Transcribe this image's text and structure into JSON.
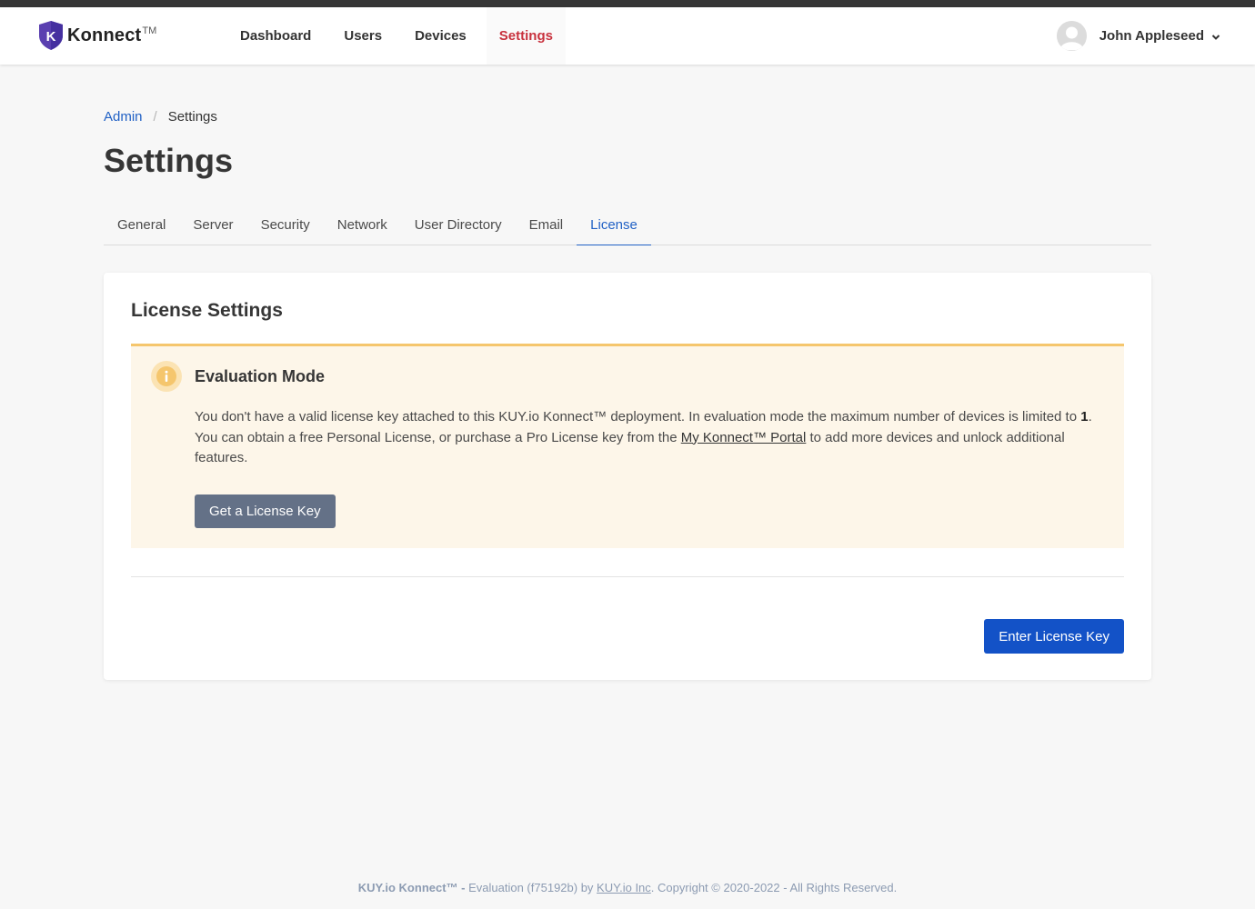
{
  "brand": {
    "name": "Konnect",
    "tm": "TM",
    "logo_letter": "K"
  },
  "nav": {
    "items": [
      {
        "label": "Dashboard"
      },
      {
        "label": "Users"
      },
      {
        "label": "Devices"
      },
      {
        "label": "Settings"
      }
    ],
    "active": "Settings"
  },
  "user": {
    "name": "John Appleseed"
  },
  "breadcrumb": {
    "parent": "Admin",
    "separator": "/",
    "current": "Settings"
  },
  "page": {
    "title": "Settings"
  },
  "tabs": [
    {
      "label": "General"
    },
    {
      "label": "Server"
    },
    {
      "label": "Security"
    },
    {
      "label": "Network"
    },
    {
      "label": "User Directory"
    },
    {
      "label": "Email"
    },
    {
      "label": "License"
    }
  ],
  "active_tab": "License",
  "card": {
    "title": "License Settings",
    "notice": {
      "title": "Evaluation Mode",
      "text_part1": "You don't have a valid license key attached to this KUY.io Konnect™ deployment. In evaluation mode the maximum number of devices is limited to ",
      "device_limit": "1",
      "text_part2": ". You can obtain a free Personal License, or purchase a Pro License key from the ",
      "link_text": "My Konnect™ Portal",
      "text_part3": " to add more devices and unlock additional features.",
      "button": "Get a License Key"
    },
    "enter_button": "Enter License Key"
  },
  "footer": {
    "product": "KUY.io Konnect™ -",
    "edition": " Evaluation (f75192b) by ",
    "company": "KUY.io Inc",
    "copyright": ". Copyright © 2020-2022 - All Rights Reserved."
  },
  "colors": {
    "accent_red": "#c8313d",
    "link_blue": "#2161c5",
    "primary_button": "#1352c7",
    "secondary_button": "#647187",
    "warning_bg": "#fdf6e9",
    "warning_border": "#f5c66d",
    "logo_shield": "#5a3fb0"
  }
}
